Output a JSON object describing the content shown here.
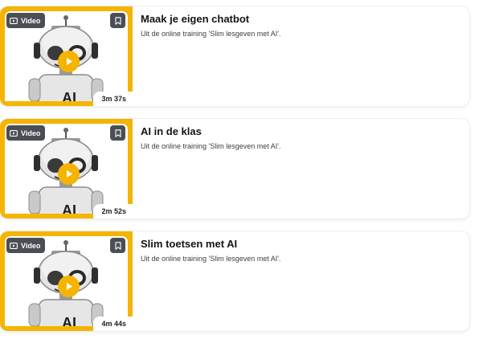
{
  "accent_color": "#f5b400",
  "badge_color": "#4a4f55",
  "items": [
    {
      "badge": "Video",
      "badge_icon": "video-icon",
      "bookmark_icon": "bookmark-icon",
      "duration": "3m 37s",
      "thumbnail_text": "AI",
      "title": "Maak je eigen chatbot",
      "subtitle": "Uit de online training 'Slim lesgeven met AI'."
    },
    {
      "badge": "Video",
      "badge_icon": "video-icon",
      "bookmark_icon": "bookmark-icon",
      "duration": "2m 52s",
      "thumbnail_text": "AI",
      "title": "AI in de klas",
      "subtitle": "Uit de online training 'Slim lesgeven met AI'."
    },
    {
      "badge": "Video",
      "badge_icon": "video-icon",
      "bookmark_icon": "bookmark-icon",
      "duration": "4m 44s",
      "thumbnail_text": "AI",
      "title": "Slim toetsen met AI",
      "subtitle": "Uit de online training 'Slim lesgeven met AI'."
    }
  ]
}
